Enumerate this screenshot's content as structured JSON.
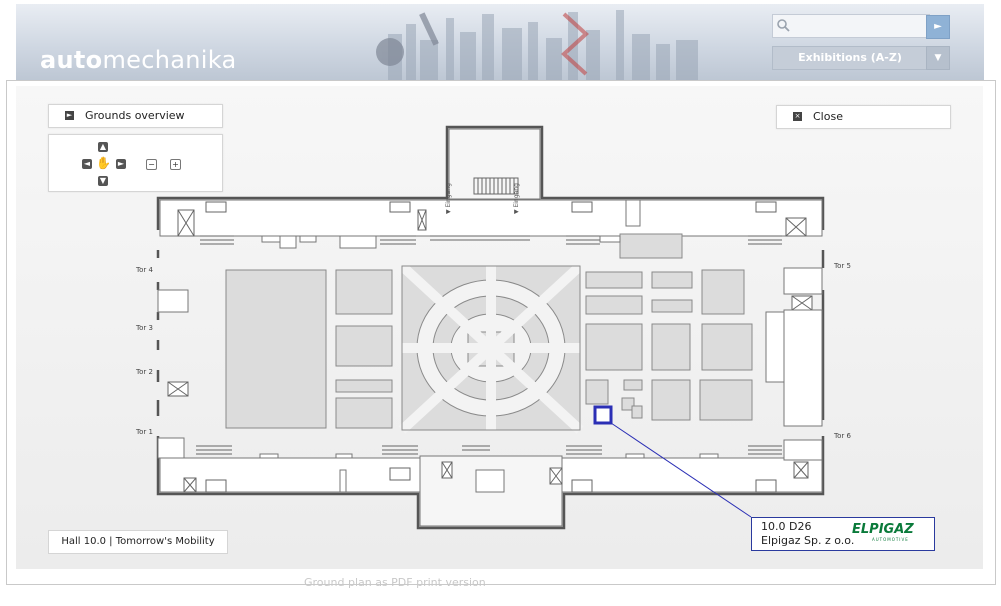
{
  "header": {
    "logo_bold": "auto",
    "logo_rest": "mechanika",
    "search": {
      "value": "",
      "placeholder": ""
    },
    "exhibitions_select": "Exhibitions (A-Z)"
  },
  "map_controls": {
    "grounds_overview": "Grounds overview",
    "close": "Close"
  },
  "hall": {
    "label": "Hall 10.0 | Tomorrow's Mobility",
    "gates": [
      "Tor 4",
      "Tor 3",
      "Tor 2",
      "Tor 1",
      "Tor 5",
      "Tor 6"
    ],
    "entrance_label": "Eingang"
  },
  "tooltip": {
    "stand": "10.0 D26",
    "company": "Elpigaz Sp. z o.o.",
    "logo_text": "ELPIGAZ",
    "logo_sub": "AUTOMOTIVE"
  },
  "footer_ghost": "Ground plan as PDF print version",
  "colors": {
    "highlight": "#2b2fb5",
    "logo_green": "#0a7a3a"
  }
}
